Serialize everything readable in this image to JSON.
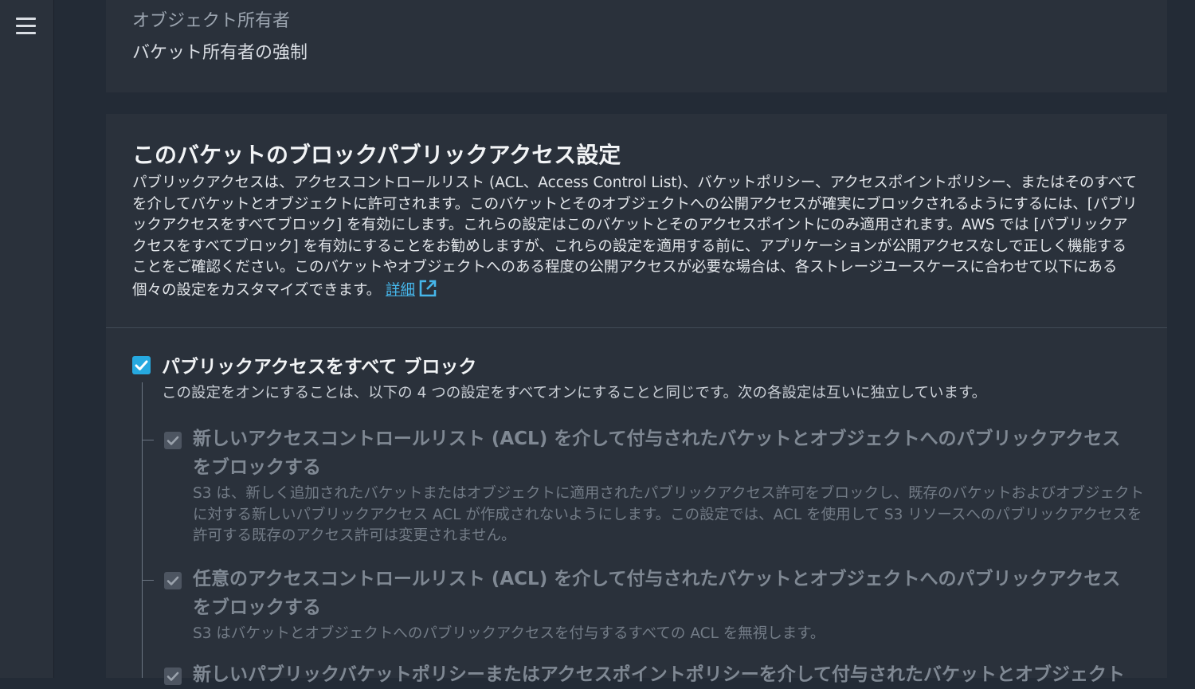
{
  "nav": {
    "menu_icon": "hamburger-menu-icon"
  },
  "ownership": {
    "label": "オブジェクト所有者",
    "value": "バケット所有者の強制"
  },
  "block_public_access": {
    "title": "このバケットのブロックパブリックアクセス設定",
    "description": "パブリックアクセスは、アクセスコントロールリスト (ACL、Access Control List)、バケットポリシー、アクセスポイントポリシー、またはそのすべてを介してバケットとオブジェクトに許可されます。このバケットとそのオブジェクトへの公開アクセスが確実にブロックされるようにするには、[パブリックアクセスをすべてブロック] を有効にします。これらの設定はこのバケットとそのアクセスポイントにのみ適用されます。AWS では [パブリックアクセスをすべてブロック] を有効にすることをお勧めしますが、これらの設定を適用する前に、アプリケーションが公開アクセスなしで正しく機能することをご確認ください。このバケットやオブジェクトへのある程度の公開アクセスが必要な場合は、各ストレージユースケースに合わせて以下にある個々の設定をカスタマイズできます。",
    "learn_more_link": "詳細",
    "link_icon": "external-link-icon",
    "block_all": {
      "label": "パブリックアクセスをすべて ブロック",
      "description": "この設定をオンにすることは、以下の 4 つの設定をすべてオンにすることと同じです。次の各設定は互いに独立しています。",
      "checked": true
    },
    "sub_settings": [
      {
        "label": "新しいアクセスコントロールリスト (ACL) を介して付与されたバケットとオブジェクトへのパブリックアクセスをブロックする",
        "description": "S3 は、新しく追加されたバケットまたはオブジェクトに適用されたパブリックアクセス許可をブロックし、既存のバケットおよびオブジェクトに対する新しいパブリックアクセス ACL が作成されないようにします。この設定では、ACL を使用して S3 リソースへのパブリックアクセスを許可する既存のアクセス許可は変更されません。",
        "checked": true,
        "disabled": true
      },
      {
        "label": "任意のアクセスコントロールリスト (ACL) を介して付与されたバケットとオブジェクトへのパブリックアクセスをブロックする",
        "description": "S3 はバケットとオブジェクトへのパブリックアクセスを付与するすべての ACL を無視します。",
        "checked": true,
        "disabled": true
      },
      {
        "label": "新しいパブリックバケットポリシーまたはアクセスポイントポリシーを介して付与されたバケットとオブジェクト",
        "checked": true,
        "disabled": true
      }
    ]
  },
  "colors": {
    "background": "#232b36",
    "panel": "#2a313b",
    "accent": "#26a9e0",
    "link": "#46b6ea"
  }
}
